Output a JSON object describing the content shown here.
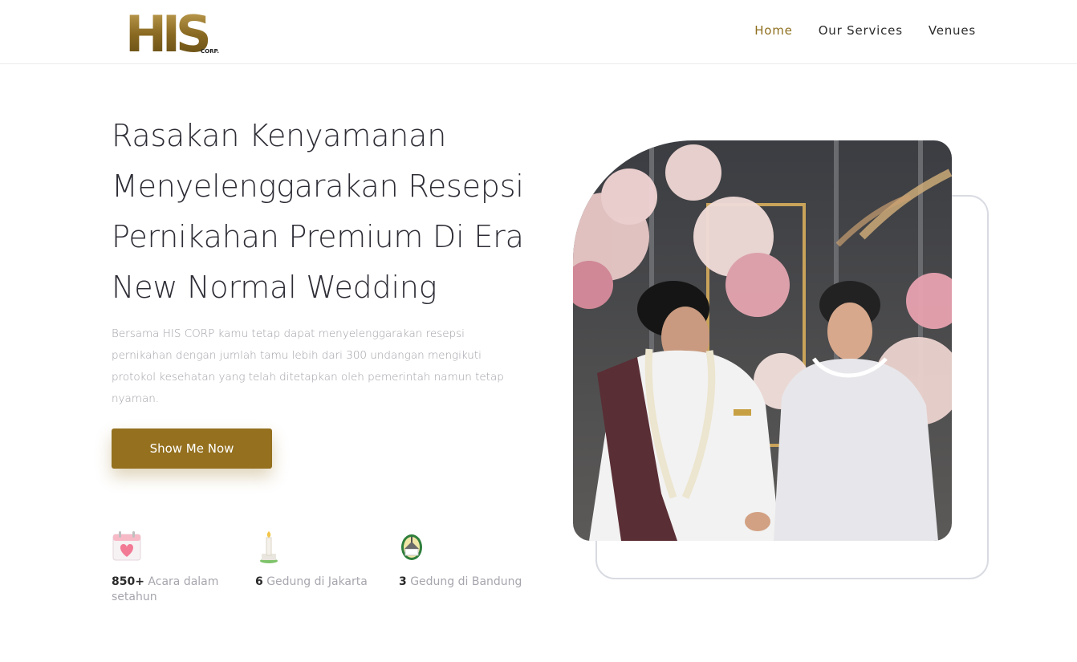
{
  "header": {
    "logo_text": "HIS",
    "logo_subtext": "CORP.",
    "nav": [
      {
        "label": "Home"
      },
      {
        "label": "Our Services"
      },
      {
        "label": "Venues"
      }
    ]
  },
  "hero": {
    "title_lines": [
      "Rasakan Kenyamanan",
      "Menyelenggarakan Resepsi",
      "Pernikahan Premium Di Era",
      "New Normal Wedding"
    ],
    "description": "Bersama HIS CORP kamu tetap dapat menyelenggarakan resepsi pernikahan dengan jumlah tamu lebih dari 300 undangan mengikuti protokol kesehatan yang telah ditetapkan oleh pemerintah namun tetap nyaman.",
    "cta_label": "Show Me Now"
  },
  "stats": [
    {
      "number": "850+",
      "label": "Acara dalam setahun",
      "icon": "calendar-heart-icon"
    },
    {
      "number": "6",
      "label": "Gedung di Jakarta",
      "icon": "monas-monument-icon"
    },
    {
      "number": "3",
      "label": "Gedung di Bandung",
      "icon": "gedung-sate-icon"
    }
  ],
  "colors": {
    "accent": "#94701f",
    "nav_active": "#8f6f1e",
    "headline": "#2d2d36",
    "muted_text": "#a0a0a8",
    "frame_border": "#d9dbe2"
  }
}
